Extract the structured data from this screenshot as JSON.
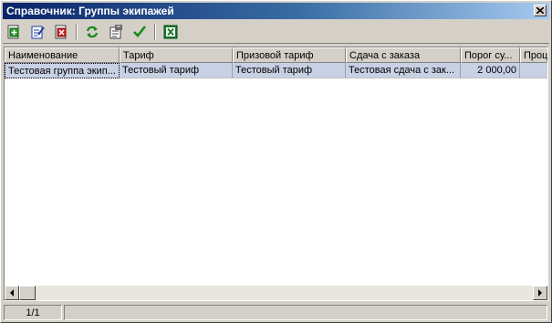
{
  "window": {
    "title": "Справочник: Группы экипажей"
  },
  "toolbar": {
    "buttons": [
      {
        "name": "add-icon"
      },
      {
        "name": "edit-icon"
      },
      {
        "name": "delete-icon"
      },
      {
        "name": "refresh-icon"
      },
      {
        "name": "properties-icon"
      },
      {
        "name": "select-check-icon"
      },
      {
        "name": "excel-export-icon"
      }
    ]
  },
  "grid": {
    "columns": [
      {
        "label": "Наименование"
      },
      {
        "label": "Тариф"
      },
      {
        "label": "Призовой тариф"
      },
      {
        "label": "Сдача с заказа"
      },
      {
        "label": "Порог су..."
      },
      {
        "label": "Проце"
      }
    ],
    "rows": [
      {
        "name": "Тестовая группа экип...",
        "tariff": "Тестовый тариф",
        "prize_tariff": "Тестовый тариф",
        "order_fee": "Тестовая сдача с зак...",
        "threshold": "2 000,00",
        "percent": ""
      }
    ]
  },
  "status": {
    "record_position": "1/1",
    "info": ""
  },
  "colors": {
    "title_start": "#0a246a",
    "title_end": "#a6caf0",
    "selected_row": "#c8d0e4",
    "face": "#d4d0c8"
  }
}
